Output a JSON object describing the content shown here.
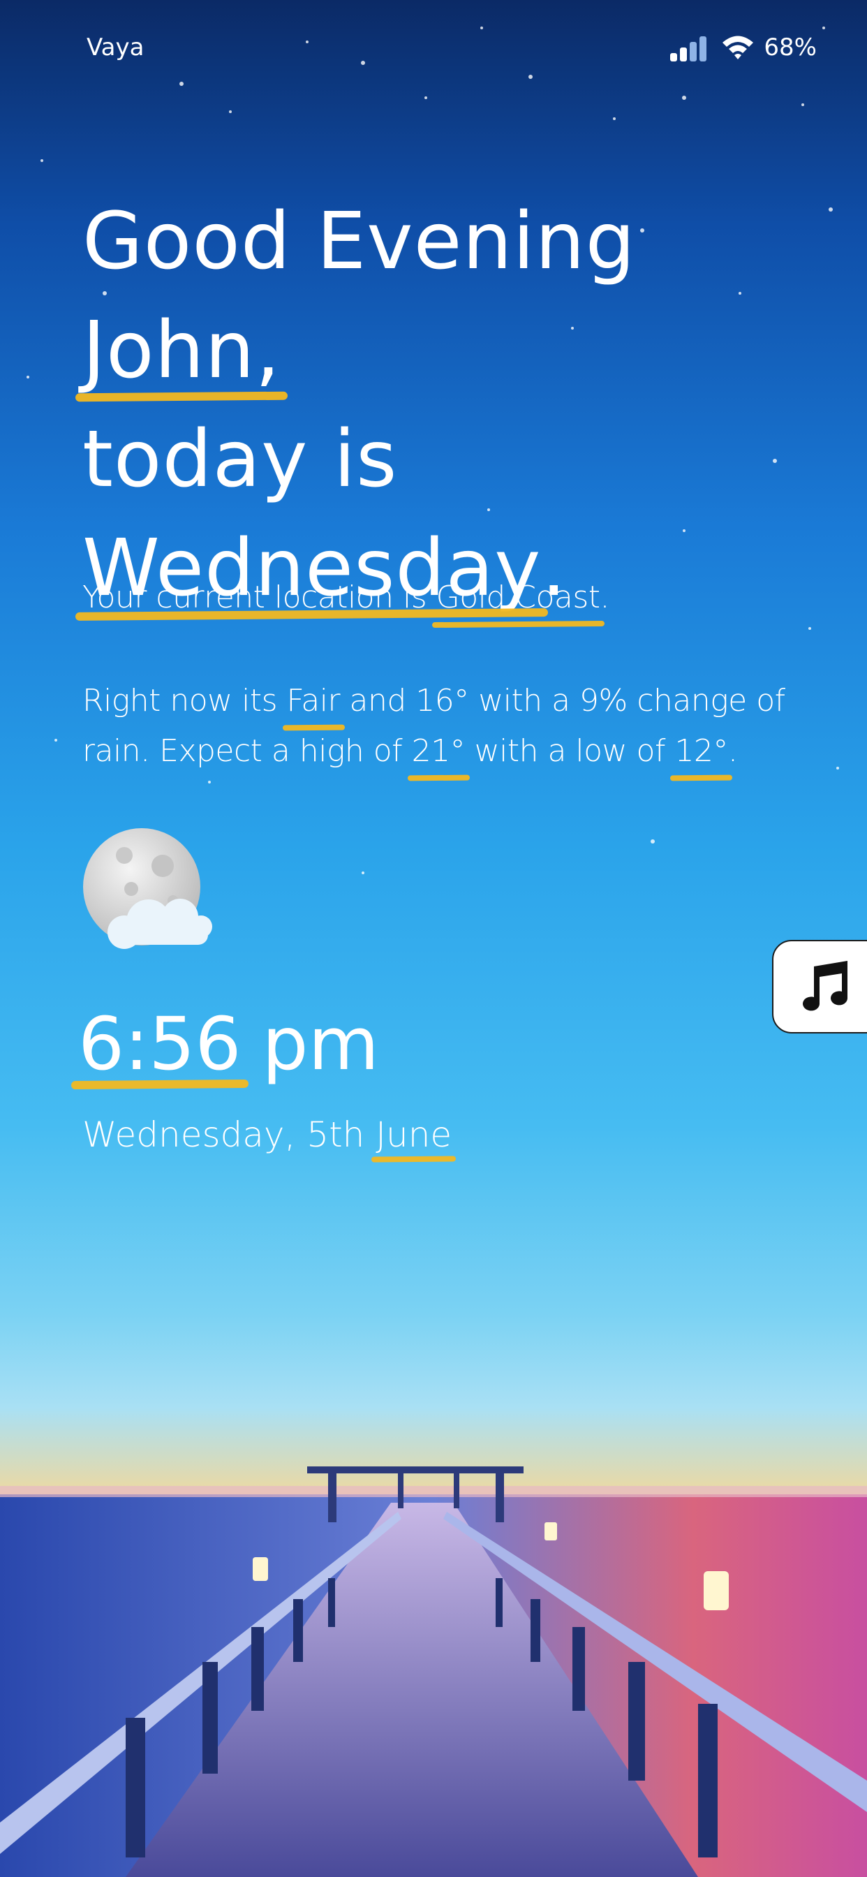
{
  "status_bar": {
    "carrier": "Vaya",
    "battery": "68%"
  },
  "greeting": {
    "line1_prefix": "Good Evening ",
    "name": "John,",
    "line2": "today is",
    "day": "Wednesday",
    "day_suffix": "."
  },
  "location": {
    "prefix": "Your current location is ",
    "city": "Gold Coast",
    "suffix": "."
  },
  "weather": {
    "prefix": "Right now its ",
    "condition": "Fair",
    "after_condition": " and 16° with a 9% change of",
    "line2_prefix": "rain. Expect a high of ",
    "high": "21°",
    "mid": " with a low of ",
    "low": "12°",
    "suffix": ".",
    "icon": "moon-cloud-icon"
  },
  "clock": {
    "time": "6:56",
    "ampm": "pm",
    "date_prefix": "Wednesday, 5th ",
    "month": "June"
  },
  "music_button": {
    "icon": "music-note-icon"
  },
  "colors": {
    "accent": "#f3b820"
  }
}
